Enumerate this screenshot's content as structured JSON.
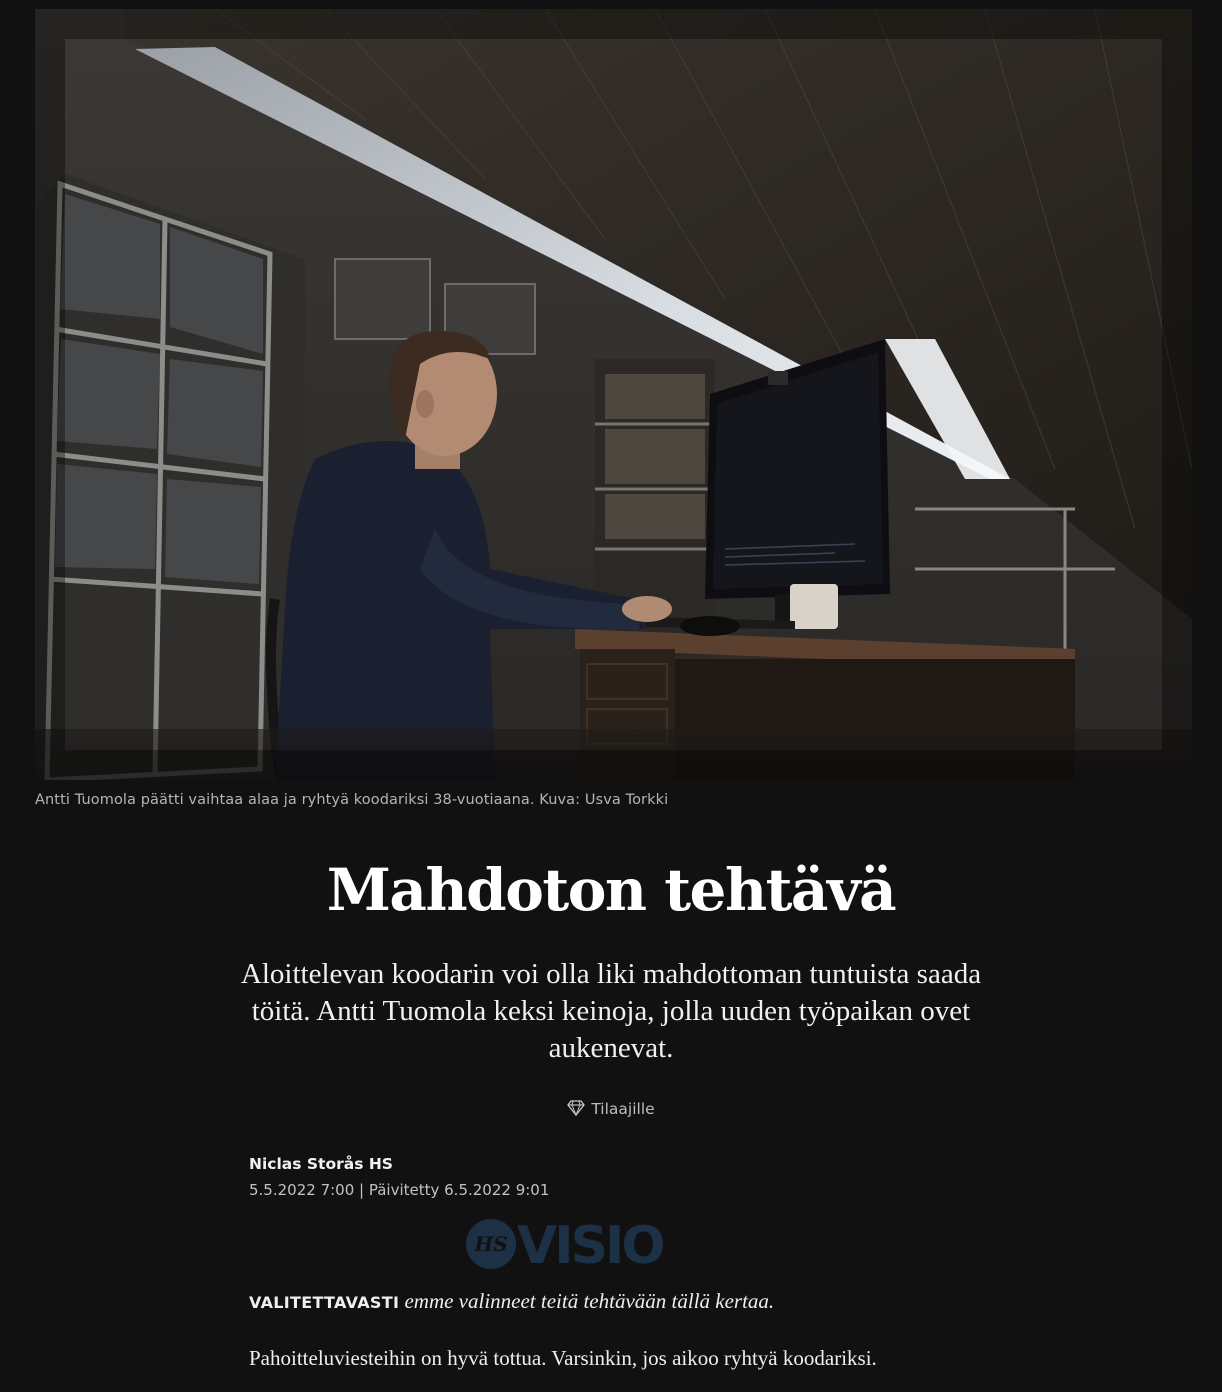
{
  "hero": {
    "image_description_icon": "photo",
    "caption": "Antti Tuomola päätti vaihtaa alaa ja ryhtyä koodariksi 38-vuotiaana. Kuva: Usva Torkki"
  },
  "article": {
    "title": "Mahdoton tehtävä",
    "lede": "Aloittelevan koodarin voi olla liki mahdottoman tuntuista saada töitä. Antti Tuomola keksi keinoja, jolla uuden työpaikan ovet aukenevat.",
    "subscriber_label": "Tilaajille",
    "subscriber_icon": "diamond-icon",
    "author": "Niclas Storås HS",
    "dates": "5.5.2022 7:00 | Päivitetty 6.5.2022 9:01",
    "section_logo_prefix": "HS",
    "section_logo": "VISIO",
    "paragraphs": [
      {
        "lead": "VALITETTAVASTI",
        "text": " emme valinneet teitä tehtävään tällä kertaa."
      },
      {
        "text": "Pahoitteluviesteihin on hyvä tottua. Varsinkin, jos aikoo ryhtyä koodariksi."
      }
    ]
  },
  "colors": {
    "background": "#111111",
    "logo": "#1d3146"
  }
}
